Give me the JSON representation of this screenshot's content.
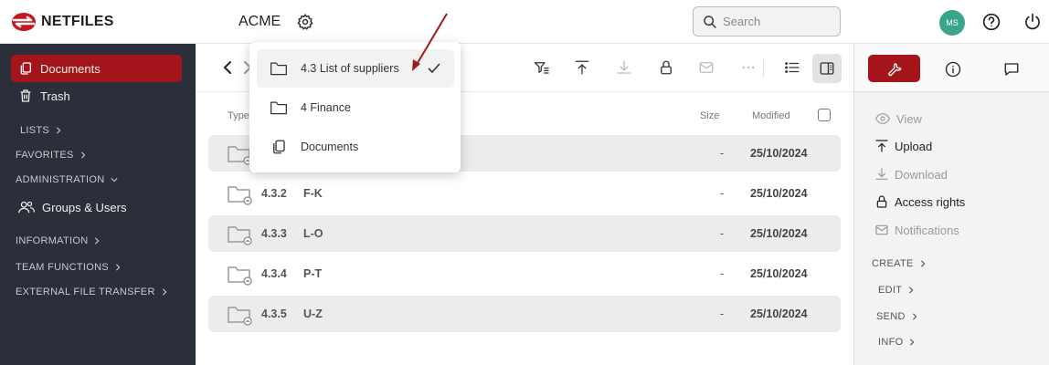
{
  "app": {
    "logo_text": "NETFILES",
    "company": "ACME"
  },
  "search": {
    "placeholder": "Search"
  },
  "user": {
    "initials": "MS"
  },
  "colors": {
    "brand": "#a3141b",
    "sidebar": "#2b2f3a",
    "avatar": "#3aa58a"
  },
  "sidebar": {
    "documents": "Documents",
    "trash": "Trash",
    "lists": "LISTS",
    "favorites": "FAVORITES",
    "administration": "ADMINISTRATION",
    "groups_users": "Groups & Users",
    "information": "INFORMATION",
    "team_functions": "TEAM FUNCTIONS",
    "external_transfer": "EXTERNAL FILE TRANSFER"
  },
  "table": {
    "col_type": "Type",
    "col_size": "Size",
    "col_modified": "Modified",
    "rows": [
      {
        "num": "",
        "name": "",
        "size": "-",
        "modified": "25/10/2024"
      },
      {
        "num": "4.3.2",
        "name": "F-K",
        "size": "-",
        "modified": "25/10/2024"
      },
      {
        "num": "4.3.3",
        "name": "L-O",
        "size": "-",
        "modified": "25/10/2024"
      },
      {
        "num": "4.3.4",
        "name": "P-T",
        "size": "-",
        "modified": "25/10/2024"
      },
      {
        "num": "4.3.5",
        "name": "U-Z",
        "size": "-",
        "modified": "25/10/2024"
      }
    ]
  },
  "breadcrumb_menu": {
    "items": [
      {
        "label": "4.3 List of suppliers"
      },
      {
        "label": "4 Finance"
      },
      {
        "label": "Documents"
      }
    ]
  },
  "right_panel": {
    "view": "View",
    "upload": "Upload",
    "download": "Download",
    "access_rights": "Access rights",
    "notifications": "Notifications",
    "create": "CREATE",
    "edit": "EDIT",
    "send": "SEND",
    "info": "INFO"
  }
}
